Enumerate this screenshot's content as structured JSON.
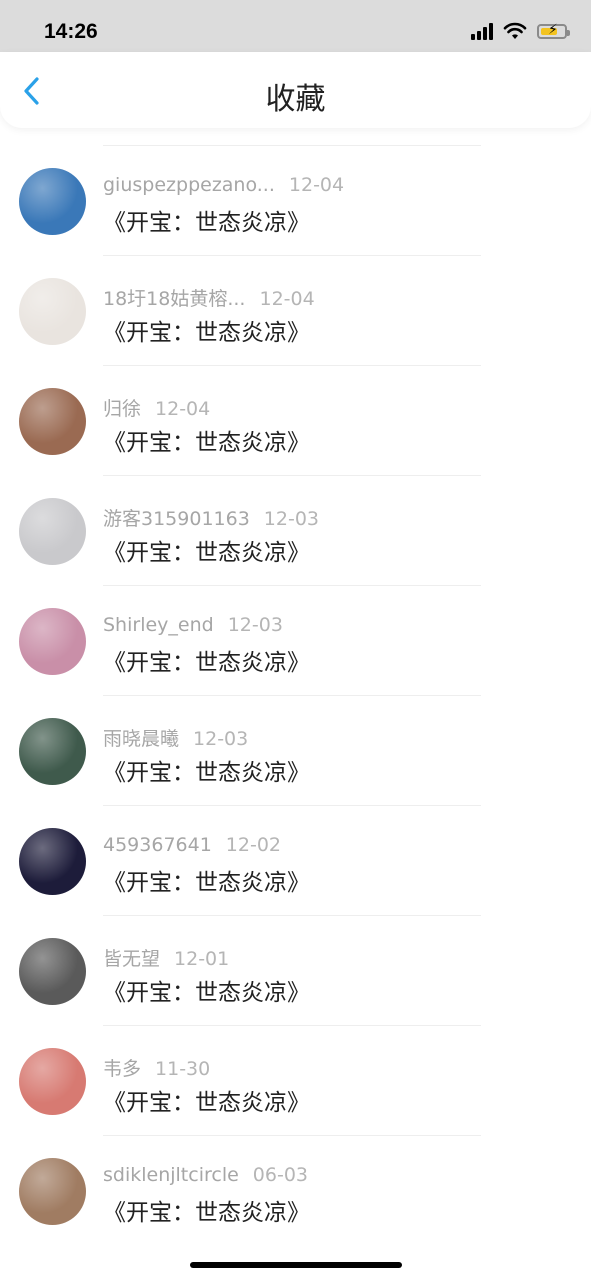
{
  "status_bar": {
    "time": "14:26"
  },
  "nav": {
    "title": "收藏"
  },
  "items": [
    {
      "user": "giuspezppezano...",
      "date": "12-04",
      "title": "《开宝：世态炎凉》",
      "avatar_color": "#3a78b8"
    },
    {
      "user": "18圩18姑黄榕...",
      "date": "12-04",
      "title": "《开宝：世态炎凉》",
      "avatar_color": "#e9e4df"
    },
    {
      "user": "归徐",
      "date": "12-04",
      "title": "《开宝：世态炎凉》",
      "avatar_color": "#9a6a52"
    },
    {
      "user": "游客315901163",
      "date": "12-03",
      "title": "《开宝：世态炎凉》",
      "avatar_color": "#c9c9cc"
    },
    {
      "user": "Shirley_end",
      "date": "12-03",
      "title": "《开宝：世态炎凉》",
      "avatar_color": "#c98fa8"
    },
    {
      "user": "雨晓晨曦",
      "date": "12-03",
      "title": "《开宝：世态炎凉》",
      "avatar_color": "#3f5a4c"
    },
    {
      "user": "459367641",
      "date": "12-02",
      "title": "《开宝：世态炎凉》",
      "avatar_color": "#1d1c3a"
    },
    {
      "user": "皆无望",
      "date": "12-01",
      "title": "《开宝：世态炎凉》",
      "avatar_color": "#5a5a5a"
    },
    {
      "user": "韦多",
      "date": "11-30",
      "title": "《开宝：世态炎凉》",
      "avatar_color": "#d77a72"
    },
    {
      "user": "sdiklenjltcircle",
      "date": "06-03",
      "title": "《开宝：世态炎凉》",
      "avatar_color": "#a07c62"
    }
  ],
  "colors": {
    "back_accent": "#2aa1e8",
    "battery_fill": "#f3c320"
  }
}
